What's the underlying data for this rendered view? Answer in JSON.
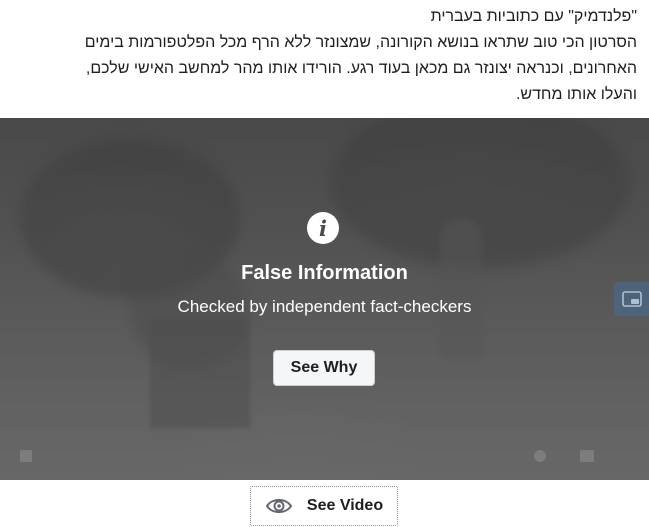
{
  "post": {
    "lines": [
      "\"פלנדמיק\" עם כתוביות בעברית",
      "הסרטון הכי טוב שתראו בנושא הקורונה, שמצונזר ללא הרף מכל הפלטפורמות בימים",
      "האחרונים, וכנראה יצונזר גם מכאן בעוד רגע. הורידו אותו מהר למחשב האישי שלכם,",
      "והעלו אותו מחדש."
    ]
  },
  "fact_check": {
    "icon": "info-icon",
    "title": "False Information",
    "subtitle": "Checked by independent fact-checkers",
    "button_label": "See Why"
  },
  "side_badge": {
    "icon": "picture-in-picture-icon",
    "color": "#466e96"
  },
  "see_video": {
    "icon": "eye-icon",
    "label": "See Video"
  },
  "colors": {
    "overlay_text": "#ffffff",
    "button_bg": "#f5f6f7",
    "body_text": "#1c1e21"
  }
}
